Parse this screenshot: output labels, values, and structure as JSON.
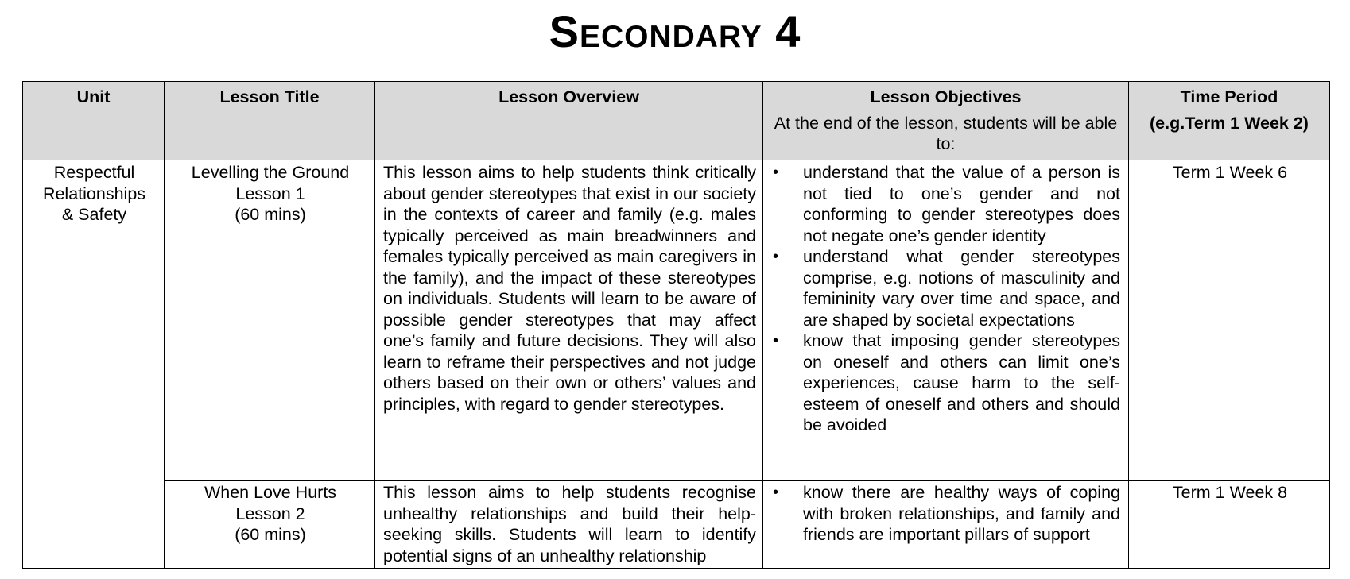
{
  "title": "Secondary 4",
  "table": {
    "headers": {
      "unit": "Unit",
      "lesson_title": "Lesson Title",
      "lesson_overview": "Lesson Overview",
      "lesson_objectives": "Lesson Objectives",
      "lesson_objectives_sub": "At the end of the lesson, students will be able to:",
      "time_period": "Time Period",
      "time_period_sub": "(e.g.Term 1 Week 2)"
    },
    "unit": [
      "Respectful",
      "Relationships",
      "& Safety"
    ],
    "rows": [
      {
        "title": [
          "Levelling the Ground",
          "Lesson 1",
          "(60 mins)"
        ],
        "overview": "This lesson aims to help students think critically about gender stereotypes that exist in our society in the contexts of career and family (e.g. males typically perceived as main breadwinners and females typically perceived as main caregivers in the family), and the impact of these stereotypes on individuals. Students will learn to be aware of possible gender stereotypes that may affect one’s family and future decisions. They will also learn to reframe their perspectives and not judge others based on their own or others’ values and principles, with regard to gender stereotypes.",
        "objectives": [
          "understand that the value of a person is not tied to one’s gender and not conforming to gender stereotypes does not negate one’s gender identity",
          "understand what gender stereotypes comprise, e.g. notions of masculinity and femininity vary over time and space, and are shaped by societal expectations",
          "know that imposing gender stereotypes on oneself and others can limit one’s experiences, cause harm to the self-esteem of oneself and others and should be avoided"
        ],
        "time": "Term 1 Week 6"
      },
      {
        "title": [
          "When Love Hurts",
          "Lesson 2",
          "(60 mins)"
        ],
        "overview": "This lesson aims to help students recognise unhealthy relationships and build their help-seeking skills. Students will learn to identify potential signs of an unhealthy relationship",
        "objectives": [
          "know there are healthy ways of coping with broken relationships, and family and friends are important pillars of support"
        ],
        "time": "Term 1 Week 8"
      }
    ]
  }
}
